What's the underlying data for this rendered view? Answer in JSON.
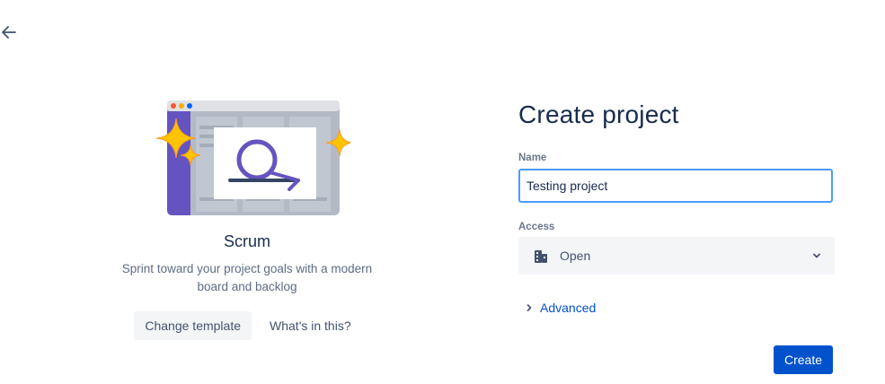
{
  "template": {
    "title": "Scrum",
    "description": "Sprint toward your project goals with a modern board and backlog",
    "change_template_label": "Change template",
    "whats_in_this_label": "What's in this?"
  },
  "form": {
    "title": "Create project",
    "name_label": "Name",
    "name_value": "Testing project",
    "access_label": "Access",
    "access_value": "Open",
    "advanced_label": "Advanced",
    "create_label": "Create"
  },
  "colors": {
    "primary": "#0052cc",
    "focus_border": "#4c9aff",
    "text": "#172b4d",
    "subtle_text": "#5e6c84",
    "illustration_purple": "#6554c0",
    "sparkle_yellow": "#ffc400"
  },
  "icons": {
    "back": "arrow-left-icon",
    "access": "building-icon",
    "select": "chevron-down-icon",
    "advanced": "chevron-right-icon"
  }
}
